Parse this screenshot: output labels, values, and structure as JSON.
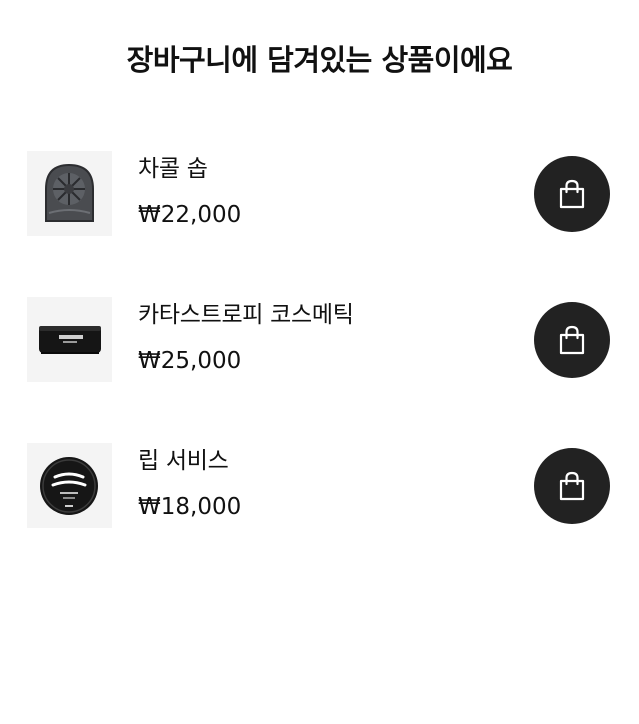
{
  "header": {
    "title": "장바구니에 담겨있는 상품이에요"
  },
  "items": [
    {
      "name": "차콜 솝",
      "price": "₩22,000",
      "image_icon": "charcoal-soap-icon"
    },
    {
      "name": "카타스트로피 코스메틱",
      "price": "₩25,000",
      "image_icon": "cosmetic-jar-icon"
    },
    {
      "name": "립 서비스",
      "price": "₩18,000",
      "image_icon": "lip-balm-tin-icon"
    }
  ],
  "actions": {
    "cart_icon": "shopping-bag-icon"
  },
  "colors": {
    "button_bg": "#222222",
    "thumb_bg": "#f4f4f4",
    "text": "#111111"
  }
}
